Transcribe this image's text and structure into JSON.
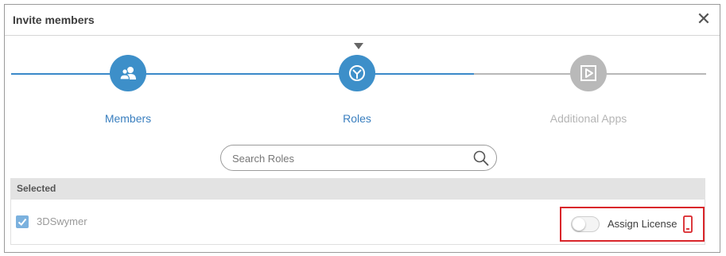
{
  "dialog": {
    "title": "Invite members",
    "close_icon": "close-icon",
    "close_glyph": "✕"
  },
  "stepper": {
    "current_step": 2,
    "steps": [
      {
        "label": "Members",
        "icon": "members-icon",
        "state": "completed"
      },
      {
        "label": "Roles",
        "icon": "roles-icon",
        "state": "active"
      },
      {
        "label": "Additional Apps",
        "icon": "apps-play-icon",
        "state": "inactive"
      }
    ]
  },
  "search": {
    "placeholder": "Search Roles",
    "value": "",
    "icon": "search-icon"
  },
  "selected": {
    "header": "Selected",
    "items": [
      {
        "name": "3DSwymer",
        "checked": true,
        "assign_license_label": "Assign License",
        "assign_license_on": false,
        "device_icon": "mobile-device-icon"
      }
    ]
  },
  "colors": {
    "accent": "#3d8fc9",
    "inactive": "#b9b9b9",
    "highlight_border": "#d9252a",
    "device_icon": "#d9252a"
  }
}
